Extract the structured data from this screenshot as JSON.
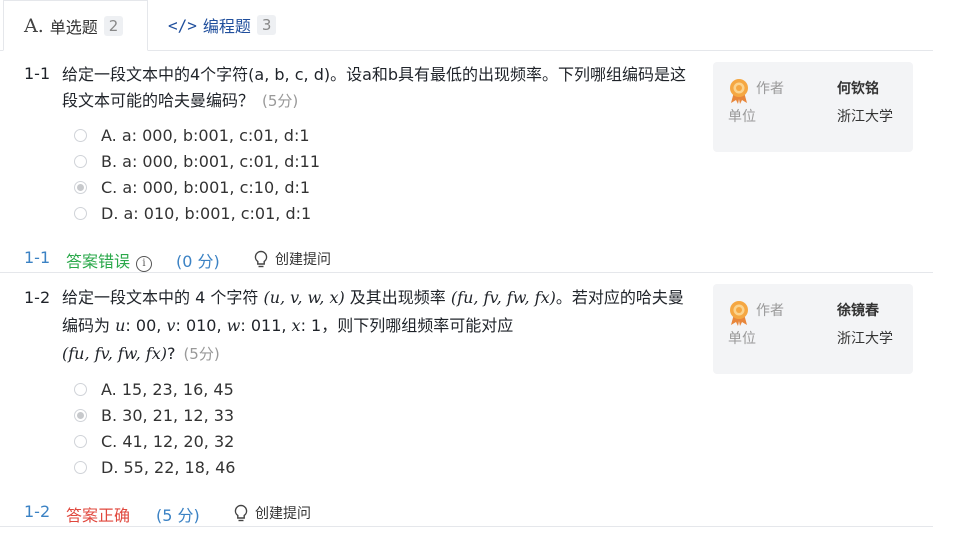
{
  "tabs": [
    {
      "icon": "A.",
      "label": "单选题",
      "count": "2"
    },
    {
      "icon": "</>",
      "label": "编程题",
      "count": "3"
    }
  ],
  "questions": [
    {
      "number": "1-1",
      "text": "给定一段文本中的4个字符(a, b, c, d)。设a和b具有最低的出现频率。下列哪组编码是这段文本可能的哈夫曼编码？",
      "score": "(5分)",
      "options": [
        {
          "label": "A. a: 000, b:001, c:01, d:1",
          "selected": false
        },
        {
          "label": "B. a: 000, b:001, c:01, d:11",
          "selected": false
        },
        {
          "label": "C. a: 000, b:001, c:10, d:1",
          "selected": true
        },
        {
          "label": "D. a: 010, b:001, c:01, d:1",
          "selected": false
        }
      ],
      "author_label": "作者",
      "author": "何钦铭",
      "unit_label": "单位",
      "unit": "浙江大学",
      "status_num": "1-1",
      "result": "答案错误",
      "points": "(0 分)",
      "ask": "创建提问"
    },
    {
      "number": "1-2",
      "text_parts": {
        "p1": "给定一段文本中的 4 个字符 ",
        "m1": "(u, v, w, x)",
        "p2": " 及其出现频率 ",
        "m2": "(fu, fv, fw, fx)",
        "p3": "。若对应的哈夫曼编码为 ",
        "m3": "u",
        "p4": ": 00, ",
        "m4": "v",
        "p5": ": 010, ",
        "m5": "w",
        "p6": ": 011, ",
        "m6": "x",
        "p7": ": 1，则下列哪组频率可能对应",
        "m7": "(fu, fv, fw, fx)",
        "p8": "?"
      },
      "score": "(5分)",
      "options": [
        {
          "label": "A. 15, 23, 16, 45",
          "selected": false
        },
        {
          "label": "B. 30, 21, 12, 33",
          "selected": true
        },
        {
          "label": "C. 41, 12, 20, 32",
          "selected": false
        },
        {
          "label": "D. 55, 22, 18, 46",
          "selected": false
        }
      ],
      "author_label": "作者",
      "author": "徐镜春",
      "unit_label": "单位",
      "unit": "浙江大学",
      "status_num": "1-2",
      "result": "答案正确",
      "points": "(5 分)",
      "ask": "创建提问"
    }
  ],
  "colors": {
    "wrong": "#2aa84a",
    "right": "#e0483e",
    "link": "#3b82c4",
    "card_bg": "#f3f4f6"
  }
}
